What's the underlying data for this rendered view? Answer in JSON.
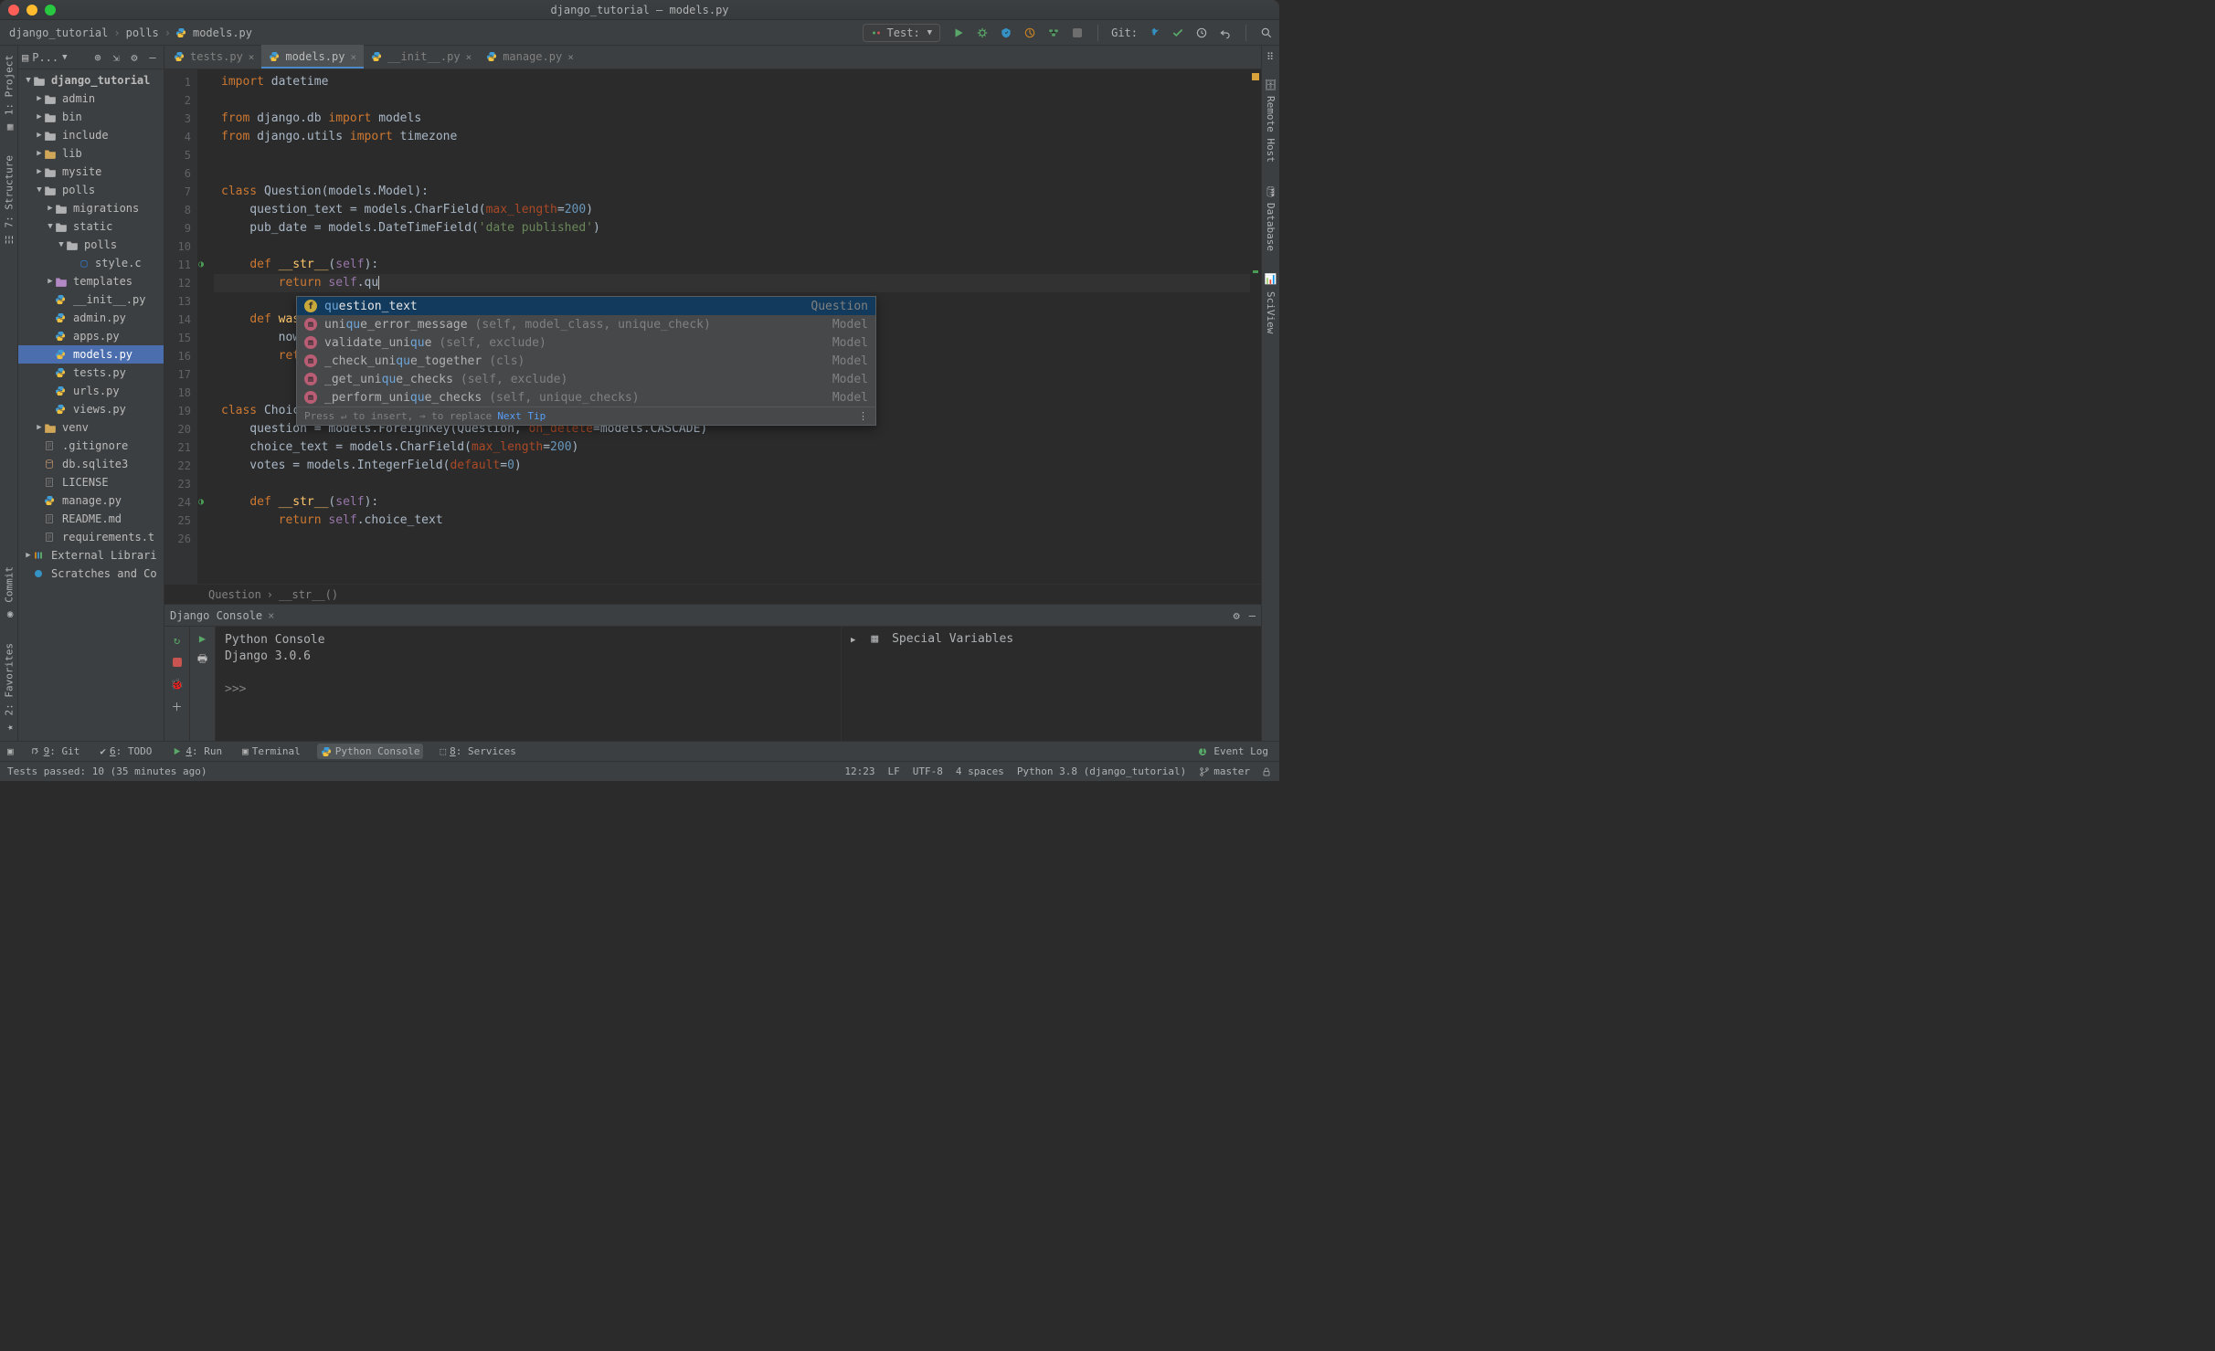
{
  "window_title": "django_tutorial – models.py",
  "breadcrumb": [
    "django_tutorial",
    "polls",
    "models.py"
  ],
  "run_config": {
    "label": "Test:"
  },
  "git_label": "Git:",
  "side_left": [
    "1: Project",
    "7: Structure",
    "Commit",
    "2: Favorites"
  ],
  "side_right": [
    "Remote Host",
    "Database",
    "SciView"
  ],
  "project": {
    "title": "P...",
    "tree": [
      {
        "d": 0,
        "tw": "▼",
        "ico": "dir",
        "label": "django_tutorial",
        "bold": true
      },
      {
        "d": 1,
        "tw": "▶",
        "ico": "dir",
        "label": "admin"
      },
      {
        "d": 1,
        "tw": "▶",
        "ico": "dir",
        "label": "bin"
      },
      {
        "d": 1,
        "tw": "▶",
        "ico": "dir",
        "label": "include"
      },
      {
        "d": 1,
        "tw": "▶",
        "ico": "dir-gold",
        "label": "lib",
        "cls": "dir-gold"
      },
      {
        "d": 1,
        "tw": "▶",
        "ico": "dir",
        "label": "mysite"
      },
      {
        "d": 1,
        "tw": "▼",
        "ico": "dir",
        "label": "polls"
      },
      {
        "d": 2,
        "tw": "▶",
        "ico": "dir",
        "label": "migrations"
      },
      {
        "d": 2,
        "tw": "▼",
        "ico": "dir",
        "label": "static"
      },
      {
        "d": 3,
        "tw": "▼",
        "ico": "dir",
        "label": "polls"
      },
      {
        "d": 4,
        "tw": "",
        "ico": "css",
        "label": "style.c"
      },
      {
        "d": 2,
        "tw": "▶",
        "ico": "dir-purple",
        "label": "templates",
        "cls": "dir-purple"
      },
      {
        "d": 2,
        "tw": "",
        "ico": "py",
        "label": "__init__.py"
      },
      {
        "d": 2,
        "tw": "",
        "ico": "py",
        "label": "admin.py"
      },
      {
        "d": 2,
        "tw": "",
        "ico": "py",
        "label": "apps.py"
      },
      {
        "d": 2,
        "tw": "",
        "ico": "py",
        "label": "models.py",
        "selected": true
      },
      {
        "d": 2,
        "tw": "",
        "ico": "py",
        "label": "tests.py"
      },
      {
        "d": 2,
        "tw": "",
        "ico": "py",
        "label": "urls.py"
      },
      {
        "d": 2,
        "tw": "",
        "ico": "py",
        "label": "views.py"
      },
      {
        "d": 1,
        "tw": "▶",
        "ico": "dir-orange",
        "label": "venv",
        "cls": "dir-gold"
      },
      {
        "d": 1,
        "tw": "",
        "ico": "txt",
        "label": ".gitignore"
      },
      {
        "d": 1,
        "tw": "",
        "ico": "db",
        "label": "db.sqlite3"
      },
      {
        "d": 1,
        "tw": "",
        "ico": "txt",
        "label": "LICENSE"
      },
      {
        "d": 1,
        "tw": "",
        "ico": "py",
        "label": "manage.py"
      },
      {
        "d": 1,
        "tw": "",
        "ico": "txt",
        "label": "README.md"
      },
      {
        "d": 1,
        "tw": "",
        "ico": "txt",
        "label": "requirements.t"
      },
      {
        "d": 0,
        "tw": "▶",
        "ico": "lib",
        "label": "External Librari"
      },
      {
        "d": 0,
        "tw": "",
        "ico": "scratch",
        "label": "Scratches and Co"
      }
    ]
  },
  "tabs": [
    {
      "label": "tests.py",
      "active": false
    },
    {
      "label": "models.py",
      "active": true
    },
    {
      "label": "__init__.py",
      "active": false
    },
    {
      "label": "manage.py",
      "active": false
    }
  ],
  "code_lines": [
    {
      "n": 1,
      "html": "<span class='kw'>import</span> datetime"
    },
    {
      "n": 2,
      "html": " "
    },
    {
      "n": 3,
      "html": "<span class='kw'>from</span> django.db <span class='kw'>import</span> models"
    },
    {
      "n": 4,
      "html": "<span class='kw'>from</span> django.utils <span class='kw'>import</span> timezone"
    },
    {
      "n": 5,
      "html": " "
    },
    {
      "n": 6,
      "html": " "
    },
    {
      "n": 7,
      "html": "<span class='kw'>class</span> <span class='decl'>Question</span>(models.Model):"
    },
    {
      "n": 8,
      "html": "    question_text = models.CharField(<span class='param'>max_length</span>=<span class='num'>200</span>)"
    },
    {
      "n": 9,
      "html": "    pub_date = models.DateTimeField(<span class='str'>'date published'</span>)"
    },
    {
      "n": 10,
      "html": " "
    },
    {
      "n": 11,
      "html": "    <span class='kw'>def</span> <span class='fn'>__str__</span>(<span class='self'>self</span>):",
      "override": true
    },
    {
      "n": 12,
      "html": "        <span class='kw'>return</span> <span class='self'>self</span>.qu<span class='caret'></span>",
      "current": true
    },
    {
      "n": 13,
      "html": " "
    },
    {
      "n": 14,
      "html": "    <span class='kw'>def</span> <span class='fn'>was_publi</span>"
    },
    {
      "n": 15,
      "html": "        now = tim"
    },
    {
      "n": 16,
      "html": "        <span class='kw'>return</span> no"
    },
    {
      "n": 17,
      "html": " "
    },
    {
      "n": 18,
      "html": " "
    },
    {
      "n": 19,
      "html": "<span class='kw'>class</span> <span class='decl'>Choice</span>(mode"
    },
    {
      "n": 20,
      "html": "    question = models.ForeignKey(Question, <span class='param'>on_delete</span>=models.CASCADE)"
    },
    {
      "n": 21,
      "html": "    choice_text = models.CharField(<span class='param'>max_length</span>=<span class='num'>200</span>)"
    },
    {
      "n": 22,
      "html": "    votes = models.IntegerField(<span class='param'>default</span>=<span class='num'>0</span>)"
    },
    {
      "n": 23,
      "html": " "
    },
    {
      "n": 24,
      "html": "    <span class='kw'>def</span> <span class='fn'>__str__</span>(<span class='self'>self</span>):",
      "override": true
    },
    {
      "n": 25,
      "html": "        <span class='kw'>return</span> <span class='self'>self</span>.choice_text"
    },
    {
      "n": 26,
      "html": " "
    }
  ],
  "editor_breadcrumb": [
    "Question",
    "__str__()"
  ],
  "completion": {
    "hint": "Press ↵ to insert, → to replace",
    "next_tip": "Next Tip",
    "items": [
      {
        "k": "f",
        "name": "question_text",
        "rest": "",
        "right": "Question"
      },
      {
        "k": "m",
        "name": "unique_error_message",
        "rest": "(self, model_class, unique_check)",
        "right": "Model"
      },
      {
        "k": "m",
        "name": "validate_unique",
        "rest": "(self, exclude)",
        "right": "Model"
      },
      {
        "k": "m",
        "name": "_check_unique_together",
        "rest": "(cls)",
        "right": "Model"
      },
      {
        "k": "m",
        "name": "_get_unique_checks",
        "rest": "(self, exclude)",
        "right": "Model"
      },
      {
        "k": "m",
        "name": "_perform_unique_checks",
        "rest": "(self, unique_checks)",
        "right": "Model"
      }
    ]
  },
  "console": {
    "tab_label": "Django Console",
    "lines": [
      "Python Console",
      "Django 3.0.6",
      "",
      ">>>"
    ],
    "special_variables": "Special Variables"
  },
  "bottom_tools": [
    {
      "key": "9",
      "label": "Git"
    },
    {
      "key": "6",
      "label": "TODO"
    },
    {
      "key": "4",
      "label": "Run",
      "run": true
    },
    {
      "key": "",
      "label": "Terminal",
      "term": true
    },
    {
      "key": "",
      "label": "Python Console",
      "active": true,
      "py": true
    },
    {
      "key": "8",
      "label": "Services",
      "svc": true
    }
  ],
  "event_log": {
    "count": "1",
    "label": "Event Log"
  },
  "status": {
    "left": "Tests passed: 10 (35 minutes ago)",
    "time": "12:23",
    "sep": "LF",
    "enc": "UTF-8",
    "indent": "4 spaces",
    "interpreter": "Python 3.8 (django_tutorial)",
    "branch": "master"
  }
}
